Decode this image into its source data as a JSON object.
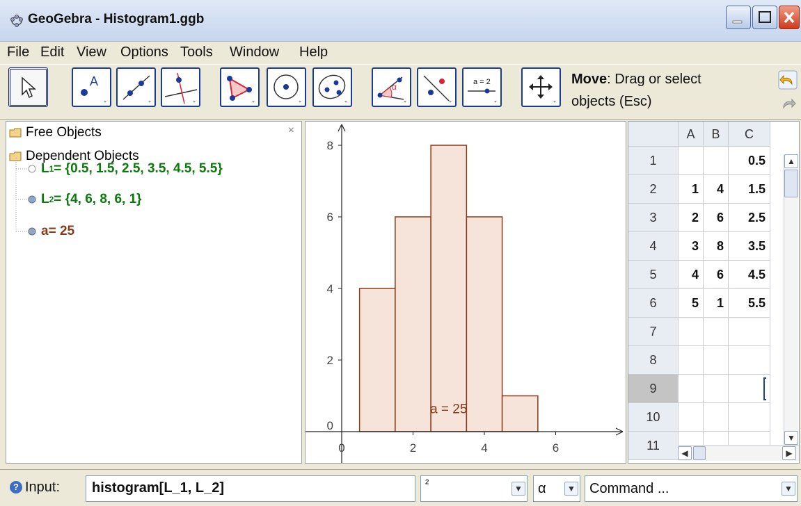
{
  "window": {
    "title": "GeoGebra - Histogram1.ggb"
  },
  "menu": {
    "items": [
      "File",
      "Edit",
      "View",
      "Options",
      "Tools",
      "Window",
      "Help"
    ]
  },
  "toolbar": {
    "tool_help_title": "Move",
    "tool_help_desc_1": ": Drag or select",
    "tool_help_desc_2": "objects (Esc)",
    "tools": [
      "move-tool",
      "new-point-tool",
      "line-tool",
      "perpendicular-line-tool",
      "polygon-tool",
      "circle-tool",
      "conic-tool",
      "angle-tool",
      "reflect-tool",
      "slider-tool",
      "move-view-tool"
    ],
    "slider_tool_label": "a = 2"
  },
  "algebra": {
    "free_objects": "Free Objects",
    "dependent_objects": "Dependent Objects",
    "items": [
      {
        "name": "L",
        "sub": "1",
        "value": " = {0.5, 1.5, 2.5, 3.5, 4.5, 5.5}",
        "color": "#0b7a0b"
      },
      {
        "name": "L",
        "sub": "2",
        "value": " = {4, 6, 8, 6, 1}",
        "color": "#0b7a0b"
      },
      {
        "name": "a",
        "sub": "",
        "value": " = 25",
        "color": "#8b3a18"
      }
    ],
    "close_glyph": "×"
  },
  "chart_data": {
    "type": "bar",
    "title": "",
    "xlabel": "",
    "ylabel": "",
    "bins": [
      [
        0.5,
        1.5
      ],
      [
        1.5,
        2.5
      ],
      [
        2.5,
        3.5
      ],
      [
        3.5,
        4.5
      ],
      [
        4.5,
        5.5
      ]
    ],
    "values": [
      4,
      6,
      8,
      6,
      1
    ],
    "xlim": [
      -0.5,
      7.5
    ],
    "ylim": [
      -0.7,
      8.7
    ],
    "x_ticks": [
      0,
      2,
      4,
      6
    ],
    "y_ticks": [
      0,
      2,
      4,
      6,
      8
    ],
    "annotation": "a = 25",
    "bar_fill": "#f6e4da",
    "bar_stroke": "#8b3a18"
  },
  "spreadsheet": {
    "columns": [
      "A",
      "B",
      "C"
    ],
    "rows": [
      {
        "n": "1",
        "A": "",
        "B": "",
        "C": "0.5"
      },
      {
        "n": "2",
        "A": "1",
        "B": "4",
        "C": "1.5"
      },
      {
        "n": "3",
        "A": "2",
        "B": "6",
        "C": "2.5"
      },
      {
        "n": "4",
        "A": "3",
        "B": "8",
        "C": "3.5"
      },
      {
        "n": "5",
        "A": "4",
        "B": "6",
        "C": "4.5"
      },
      {
        "n": "6",
        "A": "5",
        "B": "1",
        "C": "5.5"
      },
      {
        "n": "7",
        "A": "",
        "B": "",
        "C": ""
      },
      {
        "n": "8",
        "A": "",
        "B": "",
        "C": ""
      },
      {
        "n": "9",
        "A": "",
        "B": "",
        "C": ""
      },
      {
        "n": "10",
        "A": "",
        "B": "",
        "C": ""
      },
      {
        "n": "11",
        "A": "",
        "B": "",
        "C": ""
      }
    ],
    "selected_row": "9"
  },
  "inputbar": {
    "label": "Input:",
    "value": "histogram[L_1, L_2]",
    "superscript_combo": "²",
    "greek_combo": "α",
    "command_combo": "Command ..."
  }
}
